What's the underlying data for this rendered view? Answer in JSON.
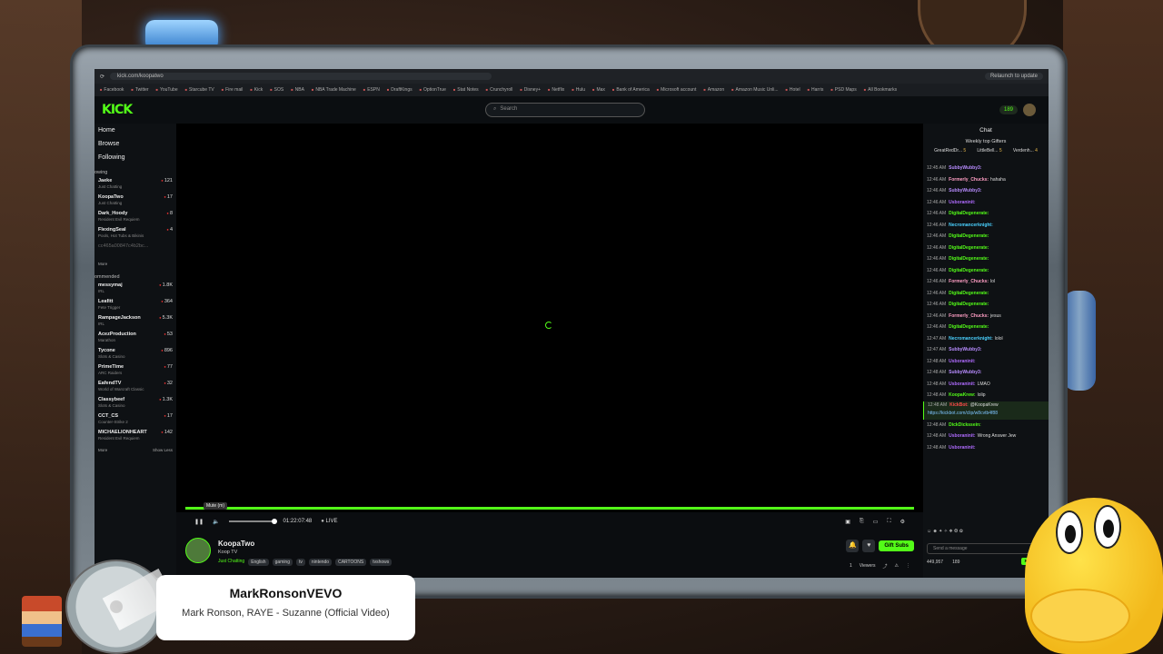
{
  "browser": {
    "url": "kick.com/koopatwo",
    "relaunch_label": "Relaunch to update",
    "bookmarks": [
      "Facebook",
      "Twitter",
      "YouTube",
      "Starcube TV",
      "Fire mail",
      "Kick",
      "SOS",
      "NBA",
      "NBA Trade Machine",
      "ESPN",
      "DraftKings",
      "OptionTrue",
      "Stat Notes",
      "Crunchyroll",
      "Disney+",
      "Netflix",
      "Hulu",
      "Max",
      "Bank of America",
      "Microsoft account",
      "Amazon",
      "Amazon Music Unli...",
      "Hotel",
      "Harris",
      "PSD Maps",
      "All Bookmarks"
    ]
  },
  "header": {
    "logo": "KICK",
    "search_placeholder": "Search",
    "points": "189"
  },
  "sidebar": {
    "nav": [
      "Home",
      "Browse",
      "Following"
    ],
    "following_label": "owing",
    "following": [
      {
        "name": "Jaeke",
        "category": "Just Chatting",
        "viewers": "121"
      },
      {
        "name": "KoopaTwo",
        "category": "Just Chatting",
        "viewers": "17"
      },
      {
        "name": "Dark_Hoody",
        "category": "Resident Evil Requiem",
        "viewers": "8"
      },
      {
        "name": "FlexingSeal",
        "category": "Pools, Hot Tubs & Bikinis",
        "viewers": "4"
      }
    ],
    "offline_item": "cc465a00847c4b2bc...",
    "show_more": "More",
    "recommended_label": "ommended",
    "recommended": [
      {
        "name": "messymaj",
        "category": "IRL",
        "viewers": "1.8K"
      },
      {
        "name": "Leafitt",
        "category": "Fete Trigger",
        "viewers": "364"
      },
      {
        "name": "RampageJackson",
        "category": "IRL",
        "viewers": "5.3K"
      },
      {
        "name": "AcezProduction",
        "category": "Marathon",
        "viewers": "53"
      },
      {
        "name": "Tycone",
        "category": "Slots & Casino",
        "viewers": "896"
      },
      {
        "name": "PrimeTime",
        "category": "ARC Raiders",
        "viewers": "77"
      },
      {
        "name": "EafendTV",
        "category": "World of Warcraft Classic",
        "viewers": "32"
      },
      {
        "name": "Classybeef",
        "category": "Slots & Casino",
        "viewers": "1.3K"
      },
      {
        "name": "CCT_CS",
        "category": "Counter-Strike 2",
        "viewers": "17"
      },
      {
        "name": "MICHAELIONHEART",
        "category": "Resident Evil Requiem",
        "viewers": "142"
      }
    ],
    "more2": "More",
    "show_less": "Show Less"
  },
  "player": {
    "tooltip": "Mute (m)",
    "timestamp": "01:22:07:48",
    "live_label": "LIVE",
    "progress": 1.0
  },
  "stream": {
    "channel": "KoopaTwo",
    "title": "Koop TV",
    "category": "Just Chatting",
    "tags": [
      "English",
      "gaming",
      "tv",
      "nintendo",
      "CARTOONS",
      "tvshows"
    ],
    "gift_label": "Gift Subs",
    "viewers_label": "Viewers",
    "viewers_count": "1"
  },
  "chat": {
    "title": "Chat",
    "top_gifters_title": "Weekly top Gifters",
    "gifters": [
      {
        "name": "GreatRedDr...",
        "count": "5"
      },
      {
        "name": "LittleBell...",
        "count": "5"
      },
      {
        "name": "Verdenh...",
        "count": "4"
      }
    ],
    "messages": [
      {
        "time": "12:45 AM",
        "user": "SubbyWubby3:",
        "text": "",
        "color": "#b88cff"
      },
      {
        "time": "12:46 AM",
        "user": "Formerly_Chucks:",
        "text": "hahaha",
        "color": "#ff9ec4"
      },
      {
        "time": "12:46 AM",
        "user": "SubbyWubby3:",
        "text": "",
        "color": "#b88cff"
      },
      {
        "time": "12:46 AM",
        "user": "Usboraninit:",
        "text": "",
        "color": "#b06bff"
      },
      {
        "time": "12:46 AM",
        "user": "DigitalDegenerate:",
        "text": "",
        "color": "#53fc18"
      },
      {
        "time": "12:46 AM",
        "user": "Necromancerknight:",
        "text": "",
        "color": "#4ad1ff"
      },
      {
        "time": "12:46 AM",
        "user": "DigitalDegenerate:",
        "text": "",
        "color": "#53fc18"
      },
      {
        "time": "12:46 AM",
        "user": "DigitalDegenerate:",
        "text": "",
        "color": "#53fc18"
      },
      {
        "time": "12:46 AM",
        "user": "DigitalDegenerate:",
        "text": "",
        "color": "#53fc18"
      },
      {
        "time": "12:46 AM",
        "user": "DigitalDegenerate:",
        "text": "",
        "color": "#53fc18"
      },
      {
        "time": "12:46 AM",
        "user": "Formerly_Chucks:",
        "text": "lol",
        "color": "#ff9ec4"
      },
      {
        "time": "12:46 AM",
        "user": "DigitalDegenerate:",
        "text": "",
        "color": "#53fc18"
      },
      {
        "time": "12:46 AM",
        "user": "DigitalDegenerate:",
        "text": "",
        "color": "#53fc18"
      },
      {
        "time": "12:46 AM",
        "user": "Formerly_Chucks:",
        "text": "jesus",
        "color": "#ff9ec4"
      },
      {
        "time": "12:46 AM",
        "user": "DigitalDegenerate:",
        "text": "",
        "color": "#53fc18"
      },
      {
        "time": "12:47 AM",
        "user": "Necromancerknight:",
        "text": "lolol",
        "color": "#4ad1ff"
      },
      {
        "time": "12:47 AM",
        "user": "SubbyWubby3:",
        "text": "",
        "color": "#b88cff"
      },
      {
        "time": "12:48 AM",
        "user": "Usboraninit:",
        "text": "",
        "color": "#b06bff"
      },
      {
        "time": "12:48 AM",
        "user": "SubbyWubby3:",
        "text": "",
        "color": "#b88cff"
      },
      {
        "time": "12:48 AM",
        "user": "Usboraninit:",
        "text": "LMAO",
        "color": "#b06bff"
      },
      {
        "time": "12:48 AM",
        "user": "KoopaKrew:",
        "text": "lolip",
        "color": "#53fc18"
      }
    ],
    "highlight": {
      "time": "12:48 AM",
      "user": "KickBot:",
      "text": "@KoopaKrew",
      "link": "https://kickbot.com/clip/w8cvtb4f88",
      "color": "#ff4a4a"
    },
    "messages2": [
      {
        "time": "12:48 AM",
        "user": "DickDickssein:",
        "text": "",
        "color": "#53fc18"
      },
      {
        "time": "12:48 AM",
        "user": "Usboraninit:",
        "text": "Wrong Answer Jew",
        "color": "#b06bff"
      },
      {
        "time": "12:48 AM",
        "user": "Usboraninit:",
        "text": "",
        "color": "#b06bff"
      }
    ],
    "input_placeholder": "Send a message",
    "balance": "449,957",
    "subs": "189"
  },
  "now_playing": {
    "artist": "MarkRonsonVEVO",
    "track": "Mark Ronson, RAYE - Suzanne (Official Video)"
  }
}
